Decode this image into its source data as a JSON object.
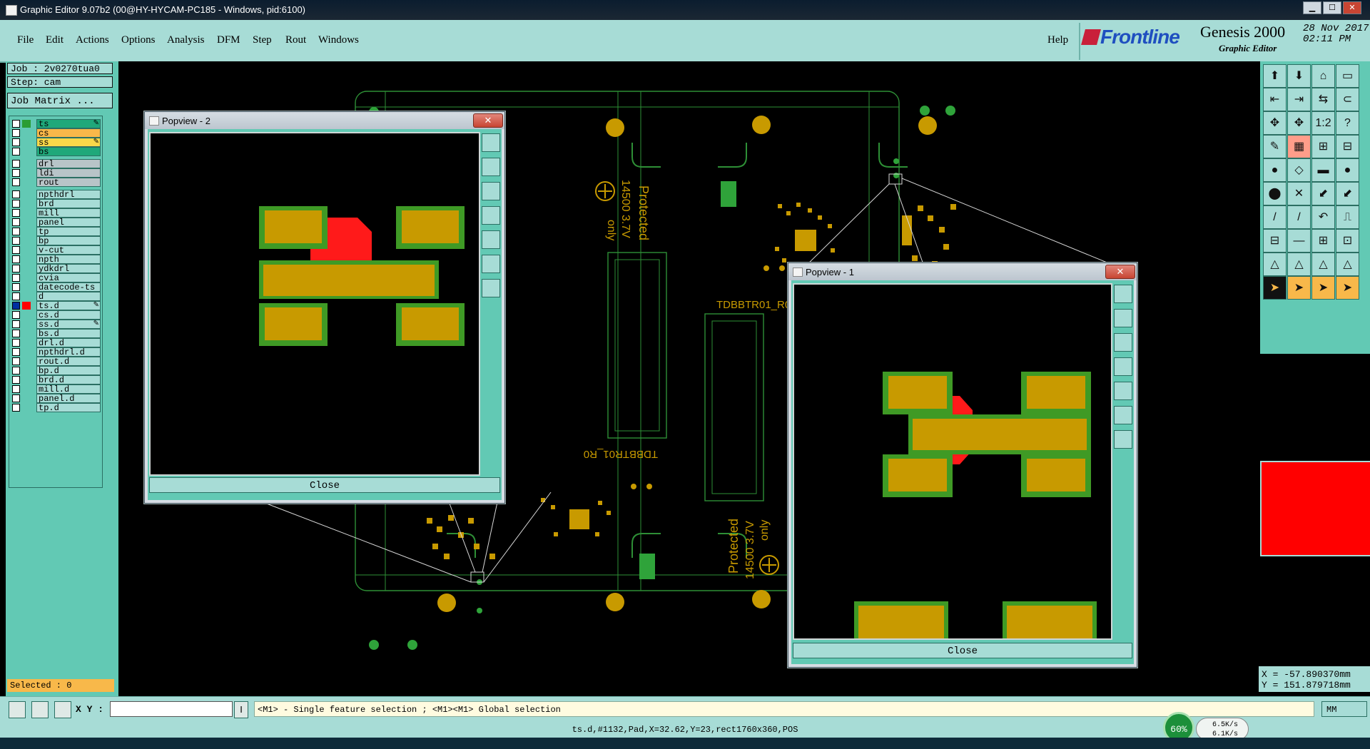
{
  "window": {
    "title": "Graphic Editor 9.07b2 (00@HY-HYCAM-PC185 - Windows, pid:6100)",
    "min": "▁",
    "max": "☐",
    "close": "✕"
  },
  "menu": {
    "items": [
      "File",
      "Edit",
      "Actions",
      "Options",
      "Analysis",
      "DFM",
      "Step",
      "Rout",
      "Windows"
    ],
    "help": "Help"
  },
  "brand": {
    "frontline": "Frontline",
    "genesis": "Genesis 2000",
    "subtitle": "Graphic Editor",
    "date": "28 Nov 2017",
    "time": "02:11 PM"
  },
  "job": {
    "job_label": "Job : 2v0270tua0",
    "step_label": "Step: cam",
    "matrix_label": "Job Matrix ..."
  },
  "layers": [
    {
      "name": "ts",
      "color": "#1fa87a",
      "swatch": "#2a9d33",
      "mark": "✎"
    },
    {
      "name": "cs",
      "color": "#f8b84a",
      "swatch": "",
      "mark": ""
    },
    {
      "name": "ss",
      "color": "#f8d84a",
      "swatch": "",
      "mark": "✎"
    },
    {
      "name": "bs",
      "color": "#1fa87a",
      "swatch": "",
      "mark": ""
    },
    {
      "name": "drl",
      "color": "#b8c4c8",
      "swatch": "",
      "mark": ""
    },
    {
      "name": "ldi",
      "color": "#b8c4c8",
      "swatch": "",
      "mark": ""
    },
    {
      "name": "rout",
      "color": "#b8c4c8",
      "swatch": "",
      "mark": ""
    },
    {
      "name": "npthdrl",
      "color": "",
      "swatch": "",
      "mark": ""
    },
    {
      "name": "brd",
      "color": "",
      "swatch": "",
      "mark": ""
    },
    {
      "name": "mill",
      "color": "",
      "swatch": "",
      "mark": ""
    },
    {
      "name": "panel",
      "color": "",
      "swatch": "",
      "mark": ""
    },
    {
      "name": "tp",
      "color": "",
      "swatch": "",
      "mark": ""
    },
    {
      "name": "bp",
      "color": "",
      "swatch": "",
      "mark": ""
    },
    {
      "name": "v-cut",
      "color": "",
      "swatch": "",
      "mark": ""
    },
    {
      "name": "npth",
      "color": "",
      "swatch": "",
      "mark": ""
    },
    {
      "name": "ydkdrl",
      "color": "",
      "swatch": "",
      "mark": ""
    },
    {
      "name": "cvia",
      "color": "",
      "swatch": "",
      "mark": ""
    },
    {
      "name": "datecode-ts",
      "color": "",
      "swatch": "",
      "mark": ""
    },
    {
      "name": "d",
      "color": "",
      "swatch": "",
      "mark": ""
    },
    {
      "name": "ts.d",
      "color": "",
      "swatch": "#ff0000",
      "mark": "✎"
    },
    {
      "name": "cs.d",
      "color": "",
      "swatch": "",
      "mark": ""
    },
    {
      "name": "ss.d",
      "color": "",
      "swatch": "",
      "mark": "✎"
    },
    {
      "name": "bs.d",
      "color": "",
      "swatch": "",
      "mark": ""
    },
    {
      "name": "drl.d",
      "color": "",
      "swatch": "",
      "mark": ""
    },
    {
      "name": "npthdrl.d",
      "color": "",
      "swatch": "",
      "mark": ""
    },
    {
      "name": "rout.d",
      "color": "",
      "swatch": "",
      "mark": ""
    },
    {
      "name": "bp.d",
      "color": "",
      "swatch": "",
      "mark": ""
    },
    {
      "name": "brd.d",
      "color": "",
      "swatch": "",
      "mark": ""
    },
    {
      "name": "mill.d",
      "color": "",
      "swatch": "",
      "mark": ""
    },
    {
      "name": "panel.d",
      "color": "",
      "swatch": "",
      "mark": ""
    },
    {
      "name": "tp.d",
      "color": "",
      "swatch": "",
      "mark": ""
    }
  ],
  "selected": "Selected : 0",
  "board": {
    "silk_text_1": "Protected",
    "silk_text_2": "14500 3.7V",
    "silk_text_3": "only",
    "silk_text_4": "TDBBTR01_R0",
    "silk_text_5": "TDBBTR01_R0",
    "silk_text_6": "Protected",
    "silk_text_7": "14500 3.7V",
    "silk_text_8": "only"
  },
  "popview2": {
    "title": "Popview - 2",
    "close_label": "Close"
  },
  "popview1": {
    "title": "Popview - 1",
    "close_label": "Close"
  },
  "coords": {
    "x": "X = -57.890370mm",
    "y": "Y = 151.879718mm"
  },
  "units": "MM",
  "cmd": {
    "xy_label": "X Y :",
    "xy_value": "",
    "hint": "<M1> - Single feature selection ; <M1><M1> Global selection"
  },
  "status": "ts.d,#1132,Pad,X=32.62,Y=23,rect1760x360,POS",
  "netmeter": {
    "percent": "60%",
    "up": "6.5K/s",
    "down": "6.1K/s"
  },
  "colors": {
    "pad": "#c89a00",
    "pad_border": "#3f9a25",
    "copper": "#ff1a1a",
    "outline": "#2e8f36",
    "teal": "#62c9b4",
    "light_teal": "#a7dcd6"
  }
}
